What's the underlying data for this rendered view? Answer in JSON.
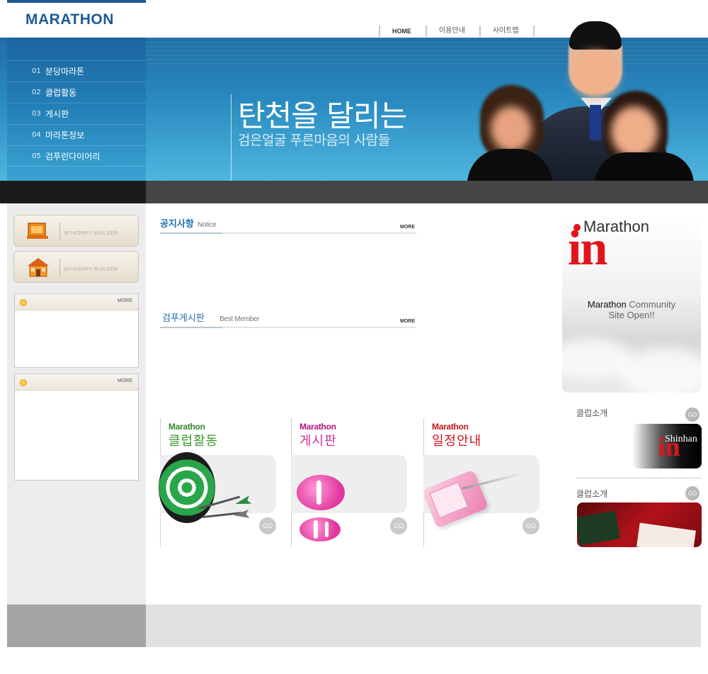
{
  "brand": {
    "logo": "MARATHON"
  },
  "top_nav": [
    {
      "label": "HOME"
    },
    {
      "label": "이용안내"
    },
    {
      "label": "사이트맵"
    }
  ],
  "side_menu": [
    {
      "num": "01",
      "label": "분당마라톤"
    },
    {
      "num": "02",
      "label": "클럽활동"
    },
    {
      "num": "03",
      "label": "게시판"
    },
    {
      "num": "04",
      "label": "마라톤정보"
    },
    {
      "num": "05",
      "label": "검푸런다이어리"
    }
  ],
  "hero": {
    "title": "탄천을 달리는",
    "subtitle": "검은얼굴 푸른마음의 사람들"
  },
  "builders": [
    {
      "label": "MYHOMPY BUILDER",
      "icon": "monitor-icon"
    },
    {
      "label": "MYHOMPY BUILDER",
      "icon": "house-icon"
    }
  ],
  "left_boxes": [
    {
      "more": "MORE"
    },
    {
      "more": "MORE"
    }
  ],
  "sections": {
    "notice": {
      "ko": "공지사항",
      "en": "Notice",
      "more": "MORE"
    },
    "best": {
      "ko": "검푸게시판",
      "en": "Best Member",
      "more": "MORE"
    }
  },
  "promos": [
    {
      "brand": "Marathon",
      "title": "클럽활동",
      "go": "GO",
      "color": "#3a9a2a"
    },
    {
      "brand": "Marathon",
      "title": "게시판",
      "go": "GO",
      "color": "#c2208e"
    },
    {
      "brand": "Marathon",
      "title": "일정안내",
      "go": "GO",
      "color": "#d3131c"
    }
  ],
  "ad": {
    "brand": "Marathon",
    "in": "in",
    "line1_strong": "Marathon",
    "line1_rest": " Community",
    "line2": "Site Open!!"
  },
  "right_sections": [
    {
      "title": "클럽소개",
      "go": "GO",
      "banner_text": "Shinhan",
      "banner_in": "in"
    },
    {
      "title": "클럽소개",
      "go": "GO"
    }
  ],
  "colors": {
    "brand_blue": "#1e5a96",
    "accent_red": "#e0151b"
  }
}
